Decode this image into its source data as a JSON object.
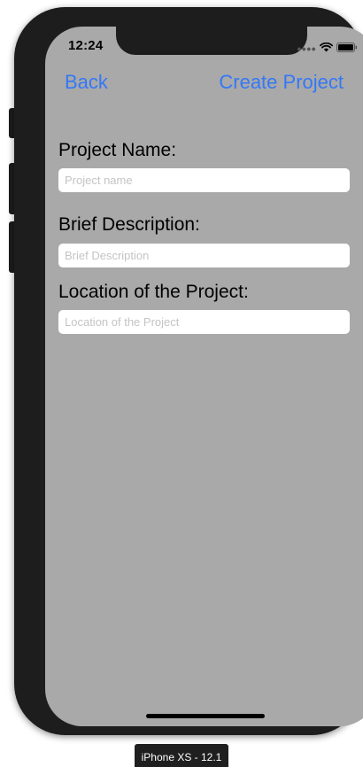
{
  "device": {
    "label": "iPhone XS - 12.1"
  },
  "status_bar": {
    "time": "12:24",
    "icons": [
      "signal-dots-icon",
      "wifi-icon",
      "battery-icon"
    ]
  },
  "nav": {
    "back_label": "Back",
    "create_label": "Create Project"
  },
  "form": {
    "project_name": {
      "label": "Project Name:",
      "placeholder": "Project name",
      "value": ""
    },
    "brief_description": {
      "label": "Brief Description:",
      "placeholder": "Brief Description",
      "value": ""
    },
    "location": {
      "label": "Location of the Project:",
      "placeholder": "Location of the Project",
      "value": ""
    }
  },
  "colors": {
    "screen_background": "#a9a9a9",
    "accent": "#3478f6",
    "device_frame": "#1d1d1d"
  }
}
